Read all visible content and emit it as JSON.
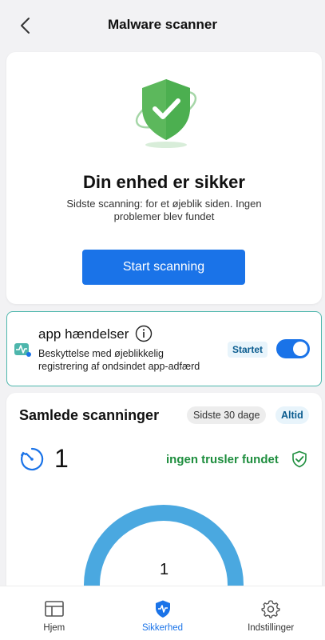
{
  "header": {
    "title": "Malware scanner",
    "back_icon": "chevron-left-icon"
  },
  "status": {
    "shield_icon": "shield-check-icon",
    "headline": "Din enhed er sikker",
    "description": "Sidste scanning: for et øjeblik siden. Ingen problemer blev fundet",
    "button_label": "Start scanning",
    "accent_color": "#1a73e8",
    "shield_color": "#4caf50"
  },
  "app_events": {
    "title": "app hændelser",
    "description": "Beskyttelse med øjeblikkelig registrering af ondsindet app-adfærd",
    "status_label": "Startet",
    "toggle_on": true,
    "border_color": "#4db6ac"
  },
  "scans": {
    "title": "Samlede scanninger",
    "filter_30_days": "Sidste 30 dage",
    "filter_always": "Altid",
    "count": "1",
    "result_text": "ingen trusler fundet",
    "result_color": "#1e8e3e",
    "donut_value": "1",
    "donut_color": "#4aa8e0"
  },
  "bottom_nav": {
    "items": [
      {
        "label": "Hjem",
        "icon": "dashboard-icon"
      },
      {
        "label": "Sikkerhed",
        "icon": "security-shield-icon"
      },
      {
        "label": "Indstillinger",
        "icon": "gear-icon"
      }
    ],
    "active_index": 1
  }
}
